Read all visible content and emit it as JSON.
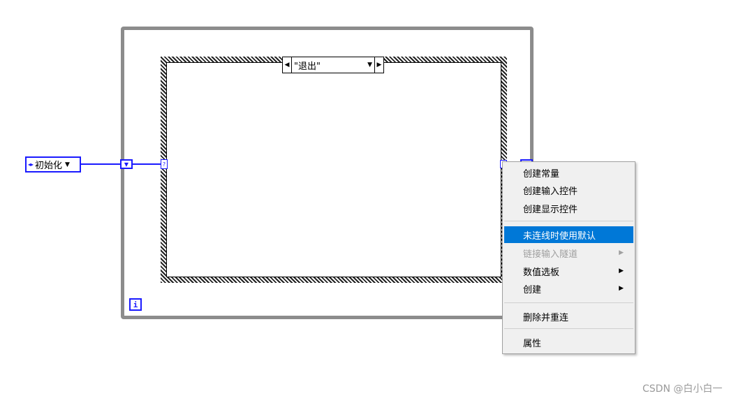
{
  "case_structure": {
    "selector_value": "\"退出\"",
    "prev_glyph": "◀",
    "next_glyph": "▶",
    "dropdown_glyph": "▼"
  },
  "enum_constant": {
    "value": "初始化",
    "inc_glyph": "◂▸",
    "dropdown_glyph": "▼"
  },
  "shift_register": {
    "left_glyph": "▼"
  },
  "case_selector_terminal": {
    "glyph": "?"
  },
  "iteration_terminal": {
    "label": "i"
  },
  "context_menu": {
    "items": [
      {
        "label": "创建常量",
        "state": "normal",
        "submenu": false
      },
      {
        "label": "创建输入控件",
        "state": "normal",
        "submenu": false
      },
      {
        "label": "创建显示控件",
        "state": "normal",
        "submenu": false
      },
      {
        "label": "未连线时使用默认",
        "state": "selected",
        "submenu": false
      },
      {
        "label": "链接输入隧道",
        "state": "disabled",
        "submenu": true
      },
      {
        "label": "数值选板",
        "state": "normal",
        "submenu": true
      },
      {
        "label": "创建",
        "state": "normal",
        "submenu": true
      },
      {
        "label": "删除并重连",
        "state": "normal",
        "submenu": false
      },
      {
        "label": "属性",
        "state": "normal",
        "submenu": false
      }
    ],
    "submenu_glyph": "▶",
    "highlight_color": "#0078d7"
  },
  "watermark": "CSDN @白小白一",
  "colors": {
    "wire": "#1a1aff",
    "loop_frame": "#8c8c8c"
  }
}
